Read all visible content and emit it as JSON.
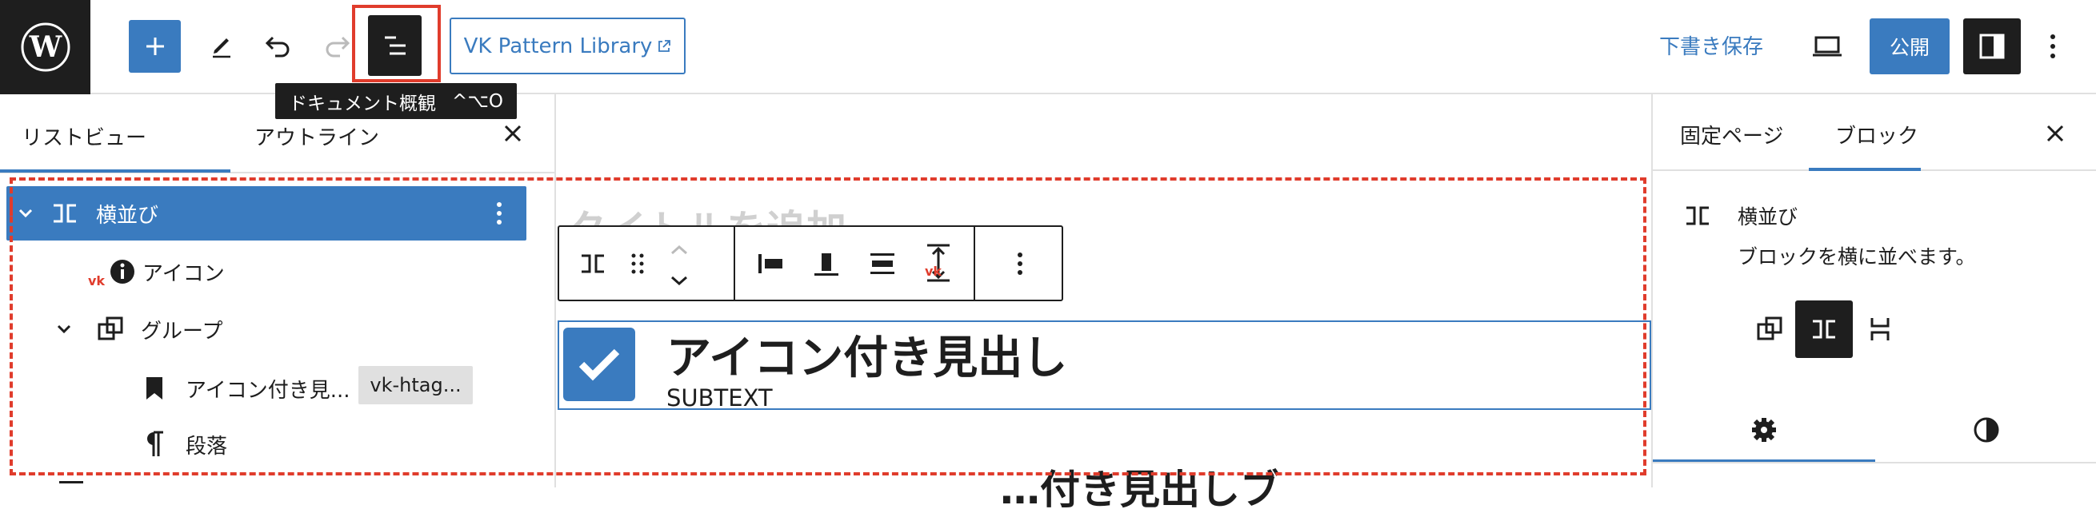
{
  "toolbar": {
    "pattern_library_label": "VK Pattern Library",
    "draft_label": "下書き保存",
    "publish_label": "公開",
    "tooltip_label": "ドキュメント概観",
    "tooltip_shortcut": "^⌥O"
  },
  "left_panel": {
    "tabs": [
      "リストビュー",
      "アウトライン"
    ],
    "items": [
      {
        "label": "横並び",
        "icon": "columns-icon"
      },
      {
        "label": "アイコン",
        "icon": "info-icon"
      },
      {
        "label": "グループ",
        "icon": "group-icon"
      },
      {
        "label": "アイコン付き見...",
        "icon": "bookmark-icon",
        "badge": "vk-htag..."
      },
      {
        "label": "段落",
        "icon": "paragraph-icon"
      }
    ]
  },
  "editor": {
    "title_placeholder": "タイトルを追加",
    "heading_text": "アイコン付き見出し",
    "subtext": "SUBTEXT",
    "partial_below_text": "…付き見出しブ"
  },
  "right_panel": {
    "tabs": [
      "固定ページ",
      "ブロック"
    ],
    "block_name": "横並び",
    "block_description": "ブロックを横に並べます。"
  },
  "colors": {
    "accent": "#3a7bbf",
    "dark": "#1e1e1e",
    "highlight": "#e03c2c"
  }
}
